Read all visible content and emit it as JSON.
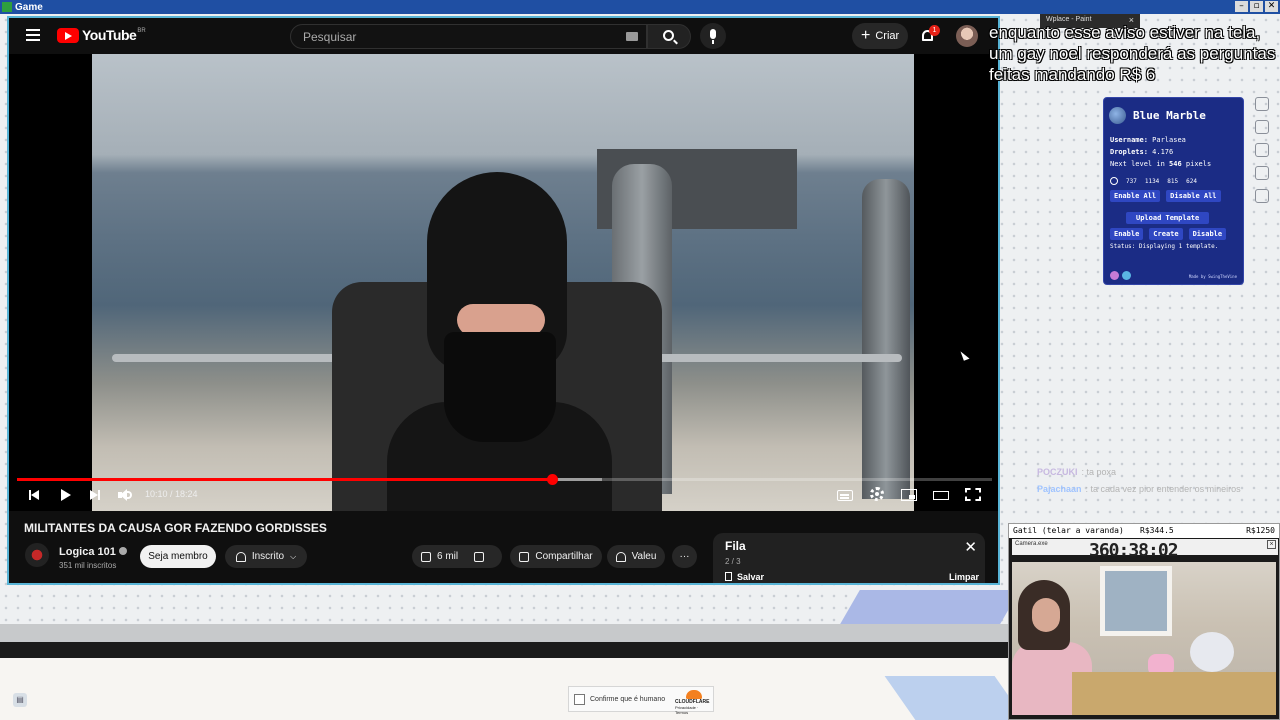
{
  "window": {
    "title": "Game",
    "controls": [
      "–",
      "▫",
      "✕"
    ]
  },
  "youtube": {
    "logo_text": "YouTube",
    "logo_region": "BR",
    "search_placeholder": "Pesquisar",
    "create_label": "Criar",
    "notification_count": "1",
    "player": {
      "time_display": "10:10 / 18:24",
      "progress_played": 0.5487,
      "progress_buffered": 0.6
    },
    "video": {
      "title": "MILITANTES DA CAUSA GOR FAZENDO GORDISSES",
      "channel_name": "Logica 101",
      "subscribers": "351 mil inscritos",
      "join_label": "Seja membro",
      "subscribed_label": "Inscrito",
      "likes": "6 mil",
      "share_label": "Compartilhar",
      "thanks_label": "Valeu",
      "more_label": "···"
    },
    "queue": {
      "title": "Fila",
      "position": "2 / 3",
      "save_label": "Salvar",
      "clear_label": "Limpar"
    }
  },
  "stream_overlay": {
    "alert_text": "enquanto esse aviso estiver na tela, um gay noel responderá as perguntas feitas mandando R$ 6",
    "browser_tab": "Wplace - Paint"
  },
  "blue_marble": {
    "title": "Blue Marble",
    "username_label": "Username:",
    "username": "Parlasea",
    "droplets_label": "Droplets:",
    "droplets": "4.176",
    "next_level_prefix": "Next level in",
    "next_level_pixels": "546",
    "next_level_suffix": "pixels",
    "coords": [
      "737",
      "1134",
      "815",
      "624"
    ],
    "enable_all": "Enable All",
    "disable_all": "Disable All",
    "upload_template": "Upload Template",
    "enable": "Enable",
    "create": "Create",
    "disable": "Disable",
    "status": "Status: Displaying 1 template.",
    "made_by": "Made by SwingTheVine"
  },
  "chat": [
    {
      "user": "POCZUKI",
      "text": ": ta poxa"
    },
    {
      "user": "Pajachaan",
      "text": ": ta cada vez pior entender os mineiros"
    }
  ],
  "cam": {
    "label": "Gatil (telar a varanda)",
    "amount": "R$344.5",
    "goal": "R$1250",
    "window_title": "Camera.exe",
    "timer": "360:38:02"
  },
  "captcha": {
    "label": "Confirme que é humano",
    "brand": "CLOUDFLARE",
    "links": "Privacidade · Termos"
  }
}
